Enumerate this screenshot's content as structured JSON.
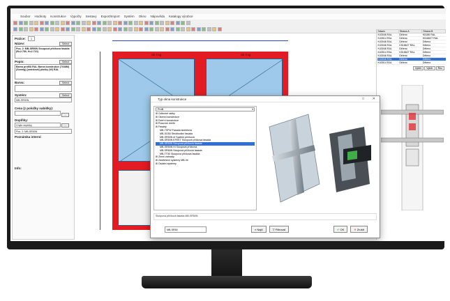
{
  "menubar": [
    "Soubor",
    "Hodnoty",
    "Konstrukce",
    "Vypočty",
    "Sestavy",
    "Export/Import",
    "Systém",
    "Okno",
    "Nápověda",
    "Katalogy výrobce"
  ],
  "left_panel": {
    "pozice_label": "Pozice:",
    "pozice_value": "1",
    "nazev_label": "Název:",
    "nazev_value": "Pos. 2: MB-SR50N Sloupová příčková fasáda (B=2.780, H=2.710)",
    "popis_label": "Popis:",
    "popis_value": "Barva profilů RAL Barva konstrukce (7038M) (Sonnig) [oranžová] plošky (W) RAL",
    "barva_label": "Barva:",
    "system_label": "Systém:",
    "system_value": "MB-SR50N",
    "select_label": "Select",
    "cena_label": "Cena (z položky nabídky):",
    "doplnky_label": "Doplňky:",
    "doplnky_value": "Chybí doplňky",
    "pos_value": "Pos. 2: MB-SR50N",
    "poznamka_label": "Poznámka interní:",
    "info_label": "Info:"
  },
  "canvas": {
    "pane_top_left_label": "SK 3 kg",
    "pane_top_right_label": "SK 3 kg"
  },
  "right_panel": {
    "headers": [
      "Název",
      "Strana A",
      "Strana B"
    ],
    "rows": [
      [
        "K43046 RAL",
        "Děleno",
        "K5186 RAL"
      ],
      [
        "K43514 RAL",
        "Děleno",
        "K518627 RAL"
      ],
      [
        "K43046 RAL",
        "Děleno",
        "Děleno"
      ],
      [
        "K43046 RAL",
        "K518627 RAL",
        "Děleno"
      ],
      [
        "K43046 RAL",
        "Děleno",
        "Děleno"
      ],
      [
        "K43514 RAL",
        "K518627 RAL",
        "Děleno"
      ],
      [
        "K43046 RAL",
        "Děleno",
        "Děleno"
      ],
      [
        "K43046 RAL",
        "Děleno",
        "Děleno"
      ],
      [
        "K43514 RAL",
        "Děleno",
        "Děleno"
      ]
    ],
    "selected_row": 7,
    "tabs": [
      "Výběr",
      "Výběr",
      "Řez"
    ]
  },
  "dialog": {
    "title": "Typ okna konstrukce",
    "filter_value": "Profil",
    "tree": [
      {
        "label": "Odborné rádky",
        "child": false
      },
      {
        "label": "Okenní konstrukce",
        "child": false
      },
      {
        "label": "Dveřní konstrukce",
        "child": false
      },
      {
        "label": "Posuvné dveře",
        "child": false
      },
      {
        "label": "Fasády",
        "child": false
      },
      {
        "label": "MB-TSFW Fasáda skeletová",
        "child": true
      },
      {
        "label": "MB-SG50 Strukturální fasáda",
        "child": true
      },
      {
        "label": "MB-SR50N ef System příčková",
        "child": true
      },
      {
        "label": "MB-SR50N EFEKT Sloupová příčková fasáda",
        "child": true
      },
      {
        "label": "MB-SR50N Sloupová příčková fasáda",
        "child": true
      },
      {
        "label": "MB-SR50N Hi Sloupová příčková",
        "child": true
      },
      {
        "label": "MB-SR60N Sloupová příčková fasáda",
        "child": true
      },
      {
        "label": "MB-TT50 Sloupová příčková fasáda",
        "child": true
      },
      {
        "label": "Zimní zahrady",
        "child": false
      },
      {
        "label": "Zastřešení systémy MB-Ve",
        "child": false
      },
      {
        "label": "Ostatní systémy",
        "child": false
      }
    ],
    "selected_tree_index": 9,
    "description": "Sloupová příčková fasáda MB-SR50N",
    "combo_value": "MB-SR50",
    "buttons": {
      "search": "Najít",
      "filter": "Filtrovat",
      "ok": "OK",
      "cancel": "Zrušit"
    }
  },
  "colors": {
    "frame": "#e31b23",
    "glass": "#9ec9ea",
    "selection": "#2f6fd6"
  }
}
